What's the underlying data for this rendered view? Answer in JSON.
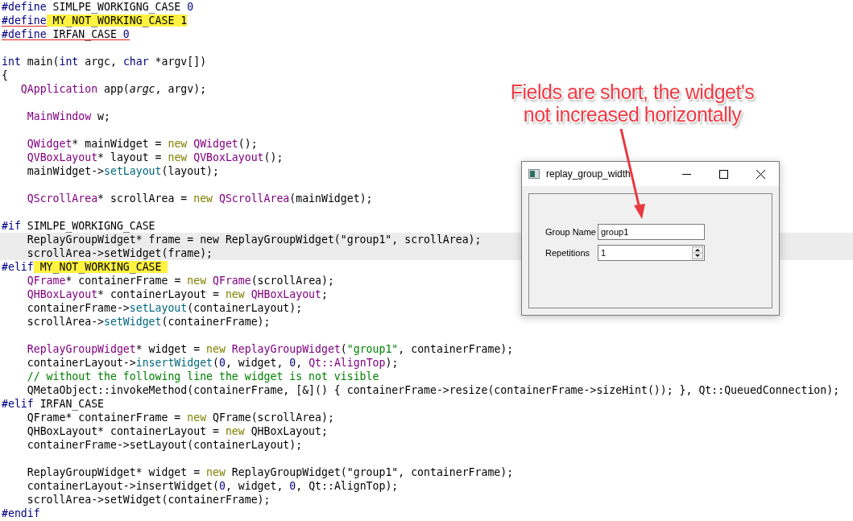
{
  "editor": {
    "lines": [
      {
        "highlighted": false,
        "underlined": false,
        "tokens": [
          {
            "kind": "preproc",
            "text": "#define"
          },
          {
            "kind": "plain",
            "text": " SIMLPE_WORKIGNG_CASE "
          },
          {
            "kind": "number",
            "text": "0"
          }
        ]
      },
      {
        "highlighted": false,
        "underlined": true,
        "tokens": [
          {
            "kind": "preproc",
            "text": "#define"
          },
          {
            "kind": "marked",
            "text": " MY_NOT_WORKING_CASE 1"
          }
        ]
      },
      {
        "highlighted": false,
        "underlined": true,
        "tokens": [
          {
            "kind": "preproc",
            "text": "#define"
          },
          {
            "kind": "plain",
            "text": " IRFAN_CASE "
          },
          {
            "kind": "number",
            "text": "0"
          }
        ]
      },
      {
        "highlighted": false,
        "underlined": false
      },
      {
        "highlighted": false,
        "underlined": false,
        "tokens": [
          {
            "kind": "keyword",
            "text": "int"
          },
          {
            "kind": "plain",
            "text": " main("
          },
          {
            "kind": "keyword",
            "text": "int"
          },
          {
            "kind": "plain",
            "text": " argc, "
          },
          {
            "kind": "keyword",
            "text": "char"
          },
          {
            "kind": "plain",
            "text": " *argv[])"
          }
        ]
      },
      {
        "highlighted": false,
        "underlined": false,
        "tokens": [
          {
            "kind": "plain",
            "text": "{"
          }
        ]
      },
      {
        "highlighted": false,
        "underlined": false,
        "tokens": [
          {
            "kind": "type",
            "text": "   QApplication"
          },
          {
            "kind": "plain",
            "text": " app("
          },
          {
            "kind": "param",
            "text": "argc"
          },
          {
            "kind": "plain",
            "text": ", argv);"
          }
        ]
      },
      {
        "highlighted": false,
        "underlined": false
      },
      {
        "highlighted": false,
        "underlined": false,
        "tokens": [
          {
            "kind": "type",
            "text": "    MainWindow"
          },
          {
            "kind": "plain",
            "text": " w;"
          }
        ]
      },
      {
        "highlighted": false,
        "underlined": false
      },
      {
        "highlighted": false,
        "underlined": false,
        "tokens": [
          {
            "kind": "type",
            "text": "    QWidget"
          },
          {
            "kind": "plain",
            "text": "* mainWidget = "
          },
          {
            "kind": "new",
            "text": "new "
          },
          {
            "kind": "type",
            "text": "QWidget"
          },
          {
            "kind": "plain",
            "text": "();"
          }
        ]
      },
      {
        "highlighted": false,
        "underlined": false,
        "tokens": [
          {
            "kind": "type",
            "text": "    QVBoxLayout"
          },
          {
            "kind": "plain",
            "text": "* layout = "
          },
          {
            "kind": "new",
            "text": "new "
          },
          {
            "kind": "type",
            "text": "QVBoxLayout"
          },
          {
            "kind": "plain",
            "text": "();"
          }
        ]
      },
      {
        "highlighted": false,
        "underlined": false,
        "tokens": [
          {
            "kind": "plain",
            "text": "    mainWidget->"
          },
          {
            "kind": "function",
            "text": "setLayout"
          },
          {
            "kind": "plain",
            "text": "(layout);"
          }
        ]
      },
      {
        "highlighted": false,
        "underlined": false
      },
      {
        "highlighted": false,
        "underlined": false,
        "tokens": [
          {
            "kind": "type",
            "text": "    QScrollArea"
          },
          {
            "kind": "plain",
            "text": "* scrollArea = "
          },
          {
            "kind": "new",
            "text": "new "
          },
          {
            "kind": "type",
            "text": "QScrollArea"
          },
          {
            "kind": "plain",
            "text": "(mainWidget);"
          }
        ]
      },
      {
        "highlighted": false,
        "underlined": false
      },
      {
        "highlighted": false,
        "underlined": false,
        "tokens": [
          {
            "kind": "preproc",
            "text": "#if"
          },
          {
            "kind": "plain",
            "text": " SIMLPE_WORKIGNG_CASE"
          }
        ]
      },
      {
        "highlighted": true,
        "underlined": false,
        "tokens": [
          {
            "kind": "plain",
            "text": "    ReplayGroupWidget* frame = new ReplayGroupWidget(\"group1\", scrollArea);"
          }
        ]
      },
      {
        "highlighted": true,
        "underlined": false,
        "tokens": [
          {
            "kind": "plain",
            "text": "    scrollArea->setWidget(frame);"
          }
        ]
      },
      {
        "highlighted": false,
        "underlined": false,
        "tokens": [
          {
            "kind": "preproc",
            "text": "#elif"
          },
          {
            "kind": "marked",
            "text": " MY_NOT_WORKING_CASE "
          }
        ]
      },
      {
        "highlighted": false,
        "underlined": false,
        "tokens": [
          {
            "kind": "type",
            "text": "    QFrame"
          },
          {
            "kind": "plain",
            "text": "* containerFrame = "
          },
          {
            "kind": "new",
            "text": "new "
          },
          {
            "kind": "type",
            "text": "QFrame"
          },
          {
            "kind": "plain",
            "text": "(scrollArea);"
          }
        ]
      },
      {
        "highlighted": false,
        "underlined": false,
        "tokens": [
          {
            "kind": "type",
            "text": "    QHBoxLayout"
          },
          {
            "kind": "plain",
            "text": "* containerLayout = "
          },
          {
            "kind": "new",
            "text": "new "
          },
          {
            "kind": "type",
            "text": "QHBoxLayout"
          },
          {
            "kind": "plain",
            "text": ";"
          }
        ]
      },
      {
        "highlighted": false,
        "underlined": false,
        "tokens": [
          {
            "kind": "plain",
            "text": "    containerFrame->"
          },
          {
            "kind": "function",
            "text": "setLayout"
          },
          {
            "kind": "plain",
            "text": "(containerLayout);"
          }
        ]
      },
      {
        "highlighted": false,
        "underlined": false,
        "tokens": [
          {
            "kind": "plain",
            "text": "    scrollArea->"
          },
          {
            "kind": "function",
            "text": "setWidget"
          },
          {
            "kind": "plain",
            "text": "(containerFrame);"
          }
        ]
      },
      {
        "highlighted": false,
        "underlined": false
      },
      {
        "highlighted": false,
        "underlined": false,
        "tokens": [
          {
            "kind": "type",
            "text": "    ReplayGroupWidget"
          },
          {
            "kind": "plain",
            "text": "* widget = "
          },
          {
            "kind": "new",
            "text": "new "
          },
          {
            "kind": "type",
            "text": "ReplayGroupWidget"
          },
          {
            "kind": "plain",
            "text": "("
          },
          {
            "kind": "string",
            "text": "\"group1\""
          },
          {
            "kind": "plain",
            "text": ", containerFrame);"
          }
        ]
      },
      {
        "highlighted": false,
        "underlined": false,
        "tokens": [
          {
            "kind": "plain",
            "text": "    containerLayout->"
          },
          {
            "kind": "function",
            "text": "insertWidget"
          },
          {
            "kind": "plain",
            "text": "("
          },
          {
            "kind": "number",
            "text": "0"
          },
          {
            "kind": "plain",
            "text": ", widget, "
          },
          {
            "kind": "number",
            "text": "0"
          },
          {
            "kind": "plain",
            "text": ", "
          },
          {
            "kind": "type",
            "text": "Qt::AlignTop"
          },
          {
            "kind": "plain",
            "text": ");"
          }
        ]
      },
      {
        "highlighted": false,
        "underlined": false,
        "tokens": [
          {
            "kind": "comment",
            "text": "    // without the following line the widget is not visible"
          }
        ]
      },
      {
        "highlighted": false,
        "underlined": false,
        "tokens": [
          {
            "kind": "plain",
            "text": "    QMetaObject::invokeMethod(containerFrame, [&]() { containerFrame->resize(containerFrame->sizeHint()); }, Qt::QueuedConnection);"
          }
        ]
      },
      {
        "highlighted": false,
        "underlined": false,
        "tokens": [
          {
            "kind": "preproc",
            "text": "#elif"
          },
          {
            "kind": "plain",
            "text": " IRFAN_CASE"
          }
        ]
      },
      {
        "highlighted": false,
        "underlined": false,
        "tokens": [
          {
            "kind": "plain",
            "text": "    QFrame* containerFrame = "
          },
          {
            "kind": "new",
            "text": "new"
          },
          {
            "kind": "plain",
            "text": " QFrame(scrollArea);"
          }
        ]
      },
      {
        "highlighted": false,
        "underlined": false,
        "tokens": [
          {
            "kind": "plain",
            "text": "    QHBoxLayout* containerLayout = "
          },
          {
            "kind": "new",
            "text": "new"
          },
          {
            "kind": "plain",
            "text": " QHBoxLayout;"
          }
        ]
      },
      {
        "highlighted": false,
        "underlined": false,
        "tokens": [
          {
            "kind": "plain",
            "text": "    containerFrame->setLayout(containerLayout);"
          }
        ]
      },
      {
        "highlighted": false,
        "underlined": false
      },
      {
        "highlighted": false,
        "underlined": false,
        "tokens": [
          {
            "kind": "plain",
            "text": "    ReplayGroupWidget* widget = "
          },
          {
            "kind": "new",
            "text": "new"
          },
          {
            "kind": "plain",
            "text": " ReplayGroupWidget(\"group1\", containerFrame);"
          }
        ]
      },
      {
        "highlighted": false,
        "underlined": false,
        "tokens": [
          {
            "kind": "plain",
            "text": "    containerLayout->insertWidget("
          },
          {
            "kind": "number",
            "text": "0"
          },
          {
            "kind": "plain",
            "text": ", widget, "
          },
          {
            "kind": "number",
            "text": "0"
          },
          {
            "kind": "plain",
            "text": ", Qt::AlignTop);"
          }
        ]
      },
      {
        "highlighted": false,
        "underlined": false,
        "tokens": [
          {
            "kind": "plain",
            "text": "    scrollArea->setWidget(containerFrame);"
          }
        ]
      },
      {
        "highlighted": false,
        "underlined": false,
        "tokens": [
          {
            "kind": "preproc",
            "text": "#endif"
          }
        ]
      }
    ]
  },
  "annotation": {
    "lines": [
      "Fields are short, the widget's",
      "not increased horizontally"
    ]
  },
  "dialog": {
    "title": "replay_group_width",
    "fields": [
      {
        "kind": "text",
        "label": "Group Name",
        "value": "group1"
      },
      {
        "kind": "spin",
        "label": "Repetitions",
        "value": "1"
      }
    ]
  }
}
